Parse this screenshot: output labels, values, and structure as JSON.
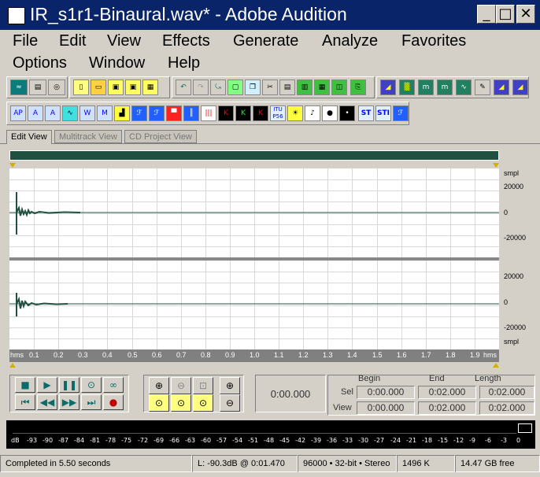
{
  "window": {
    "title": "IR_s1r1-Binaural.wav* - Adobe Audition",
    "buttons": {
      "minimize": "_",
      "maximize": "□",
      "close": "✕"
    }
  },
  "menu": [
    {
      "label": "File"
    },
    {
      "label": "Edit"
    },
    {
      "label": "View"
    },
    {
      "label": "Effects"
    },
    {
      "label": "Generate"
    },
    {
      "label": "Analyze"
    },
    {
      "label": "Favorites"
    },
    {
      "label": "Options"
    },
    {
      "label": "Window"
    },
    {
      "label": "Help"
    }
  ],
  "toolbar2": {
    "labels": [
      "AP",
      "ITU P56",
      "ST",
      "STI"
    ]
  },
  "tabs": [
    {
      "label": "Edit View",
      "active": true
    },
    {
      "label": "Multitrack View",
      "active": false
    },
    {
      "label": "CD Project View",
      "active": false
    }
  ],
  "waveform": {
    "unit": "smpl",
    "channel_top_labels": [
      "20000",
      "0",
      "-20000"
    ],
    "channel_bottom_labels": [
      "20000",
      "0",
      "-20000"
    ],
    "bottom_unit": "smpl",
    "time_axis_unit": "hms",
    "time_ticks": [
      "0.1",
      "0.2",
      "0.3",
      "0.4",
      "0.5",
      "0.6",
      "0.7",
      "0.8",
      "0.9",
      "1.0",
      "1.1",
      "1.2",
      "1.3",
      "1.4",
      "1.5",
      "1.6",
      "1.7",
      "1.8",
      "1.9"
    ],
    "time_unit_right": "hms",
    "wave_color": "#1f5040",
    "grid_color": "#d0d0d0"
  },
  "transport": {
    "time_display": "0:00.000"
  },
  "selection": {
    "headers": {
      "begin": "Begin",
      "end": "End",
      "length": "Length"
    },
    "sel_label": "Sel",
    "view_label": "View",
    "sel": {
      "begin": "0:00.000",
      "end": "0:02.000",
      "length": "0:02.000"
    },
    "view": {
      "begin": "0:00.000",
      "end": "0:02.000",
      "length": "0:02.000"
    }
  },
  "meter": {
    "labels": [
      "dB",
      "-93",
      "-90",
      "-87",
      "-84",
      "-81",
      "-78",
      "-75",
      "-72",
      "-69",
      "-66",
      "-63",
      "-60",
      "-57",
      "-54",
      "-51",
      "-48",
      "-45",
      "-42",
      "-39",
      "-36",
      "-33",
      "-30",
      "-27",
      "-24",
      "-21",
      "-18",
      "-15",
      "-12",
      "-9",
      "-6",
      "-3",
      "0"
    ]
  },
  "status": {
    "message": "Completed in 5.50 seconds",
    "level": "L: -90.3dB @  0:01.470",
    "format": "96000 • 32-bit • Stereo",
    "size": "1496 K",
    "free": "14.47 GB free"
  }
}
